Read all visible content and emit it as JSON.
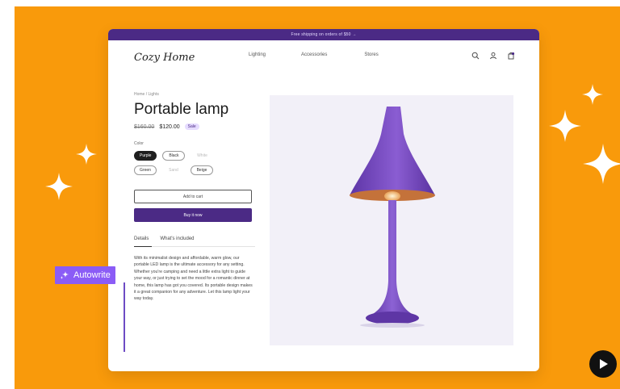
{
  "store": {
    "banner_text": "Free shipping on orders of $50 →",
    "brand": "Cozy Home",
    "nav_links": [
      "Lighting",
      "Accessories",
      "Stores"
    ],
    "nav_icons": [
      "search-icon",
      "account-icon",
      "cart-icon"
    ]
  },
  "product": {
    "breadcrumb": "Home / Lights",
    "title": "Portable lamp",
    "old_price": "$160.00",
    "new_price": "$120.00",
    "badge": "Sale",
    "color_label": "Color",
    "colors": [
      {
        "label": "Purple",
        "state": "selected"
      },
      {
        "label": "Black",
        "state": "normal"
      },
      {
        "label": "White",
        "state": "disabled"
      },
      {
        "label": "Green",
        "state": "normal"
      },
      {
        "label": "Sand",
        "state": "disabled"
      },
      {
        "label": "Beige",
        "state": "normal"
      }
    ],
    "add_to_cart_label": "Add to cart",
    "buy_now_label": "Buy it now",
    "tabs": [
      "Details",
      "What's included"
    ],
    "description": "With its minimalist design and affordable, warm glow, our portable LED lamp is the ultimate accessory for any setting. Whether you're camping and need a little extra light to guide your way, or just trying to set the mood for a romantic dinner at home, this lamp has got you covered. Its portable design makes it a great companion for any adventure. Let this lamp light your way today."
  },
  "overlay": {
    "autowrite_label": "Autowrite",
    "play_icon": "play-icon"
  },
  "colors": {
    "background": "#f99a0b",
    "brand_purple": "#4b2a85",
    "autowrite_purple": "#8b5cf6",
    "lamp_purple": "#7b4fc0"
  }
}
